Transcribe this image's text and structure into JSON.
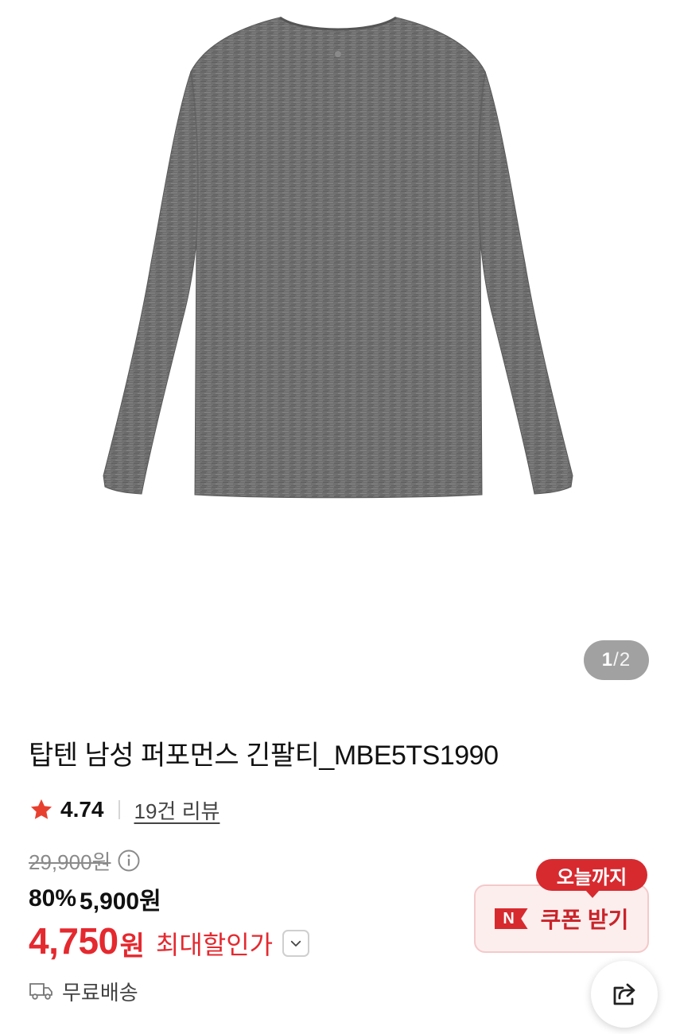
{
  "gallery": {
    "current": "1",
    "separator": "/",
    "total": "2"
  },
  "product": {
    "title": "탑텐 남성 퍼포먼스 긴팔티_MBE5TS1990",
    "rating": "4.74",
    "review_link": "19건 리뷰",
    "original_price": "29,900원",
    "discount": "80%",
    "sale_price": "5,900원",
    "max_price": "4,750",
    "max_unit": "원",
    "max_label": "최대할인가",
    "shipping": "무료배송"
  },
  "coupon": {
    "tooltip": "오늘까지",
    "badge": "N",
    "label": "쿠폰 받기"
  },
  "colors": {
    "accent_red": "#e4292f",
    "coupon_red": "#d72a2f",
    "coupon_bg": "#fdeeee",
    "star": "#e8402f",
    "shirt": "#6f6f6f"
  },
  "icons": [
    "star-icon",
    "info-icon",
    "chevron-down-icon",
    "truck-icon",
    "share-icon"
  ]
}
